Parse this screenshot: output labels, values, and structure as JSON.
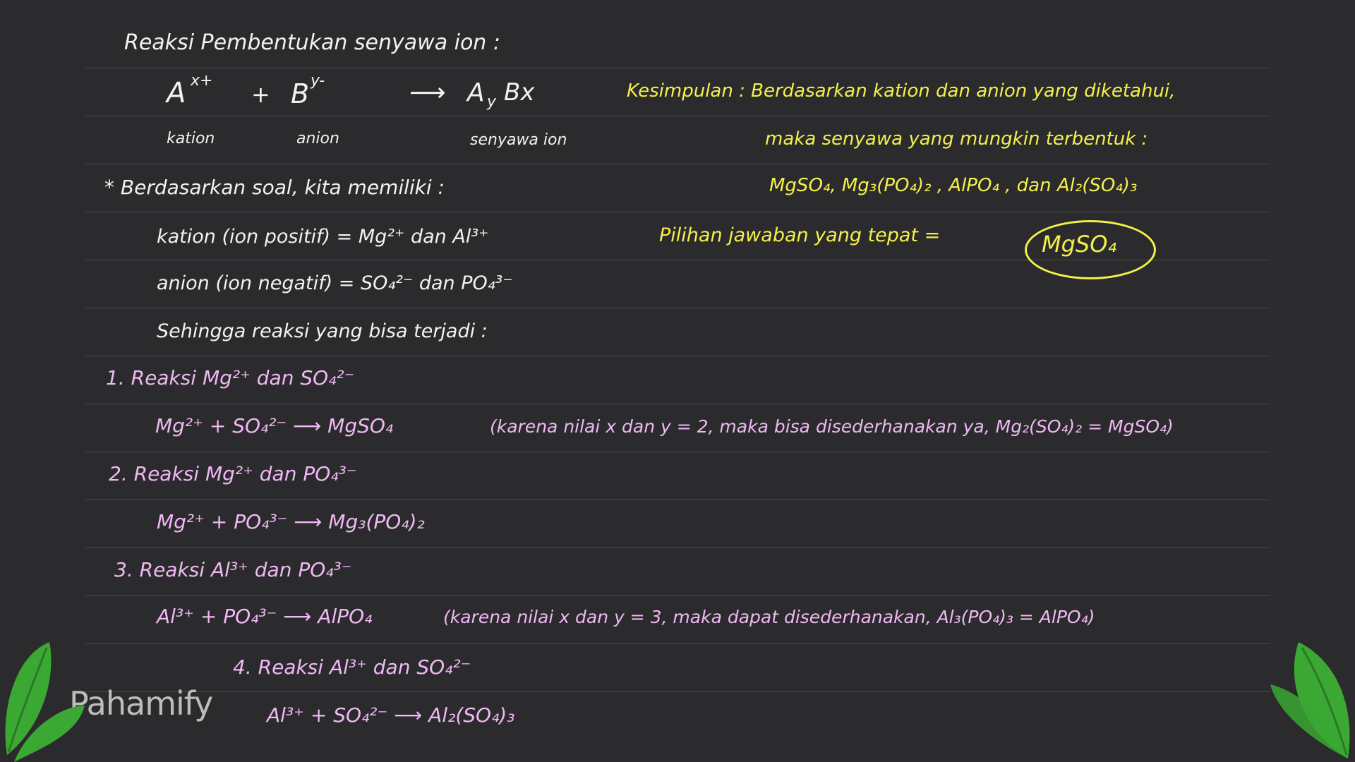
{
  "title": "Reaksi Pembentukan senyawa ion :",
  "general": {
    "cation": "A",
    "cation_charge": "x+",
    "plus": "+",
    "anion": "B",
    "anion_charge": "y-",
    "arrow": "⟶",
    "product": "A",
    "product_sub1": "y",
    "product_b": "Bx",
    "label_cation": "kation",
    "label_anion": "anion",
    "label_product": "senyawa ion"
  },
  "given": {
    "intro": "* Berdasarkan soal, kita memiliki :",
    "cation_line": "kation (ion positif)  =  Mg²⁺  dan  Al³⁺",
    "anion_line": "anion  (ion negatif)  =  SO₄²⁻  dan  PO₄³⁻",
    "so_line": "Sehingga reaksi yang bisa terjadi :"
  },
  "reactions": [
    {
      "heading": "1. Reaksi Mg²⁺ dan SO₄²⁻",
      "equation": "Mg²⁺ + SO₄²⁻  ⟶  MgSO₄",
      "note": "(karena nilai x dan y = 2, maka bisa disederhanakan ya, Mg₂(SO₄)₂ = MgSO₄)"
    },
    {
      "heading": "2. Reaksi Mg²⁺ dan PO₄³⁻",
      "equation": "Mg²⁺ + PO₄³⁻  ⟶  Mg₃(PO₄)₂",
      "note": ""
    },
    {
      "heading": "3. Reaksi Al³⁺ dan PO₄³⁻",
      "equation": "Al³⁺ + PO₄³⁻  ⟶  AlPO₄",
      "note": "(karena nilai x dan y = 3, maka dapat disederhanakan, Al₃(PO₄)₃ = AlPO₄)"
    },
    {
      "heading": "4. Reaksi Al³⁺ dan SO₄²⁻",
      "equation": "Al³⁺ + SO₄²⁻  ⟶  Al₂(SO₄)₃",
      "note": ""
    }
  ],
  "conclusion": {
    "line1": "Kesimpulan :  Berdasarkan kation dan anion yang diketahui,",
    "line2": "maka senyawa yang mungkin terbentuk :",
    "line3": "MgSO₄,  Mg₃(PO₄)₂ ,  AlPO₄ ,  dan  Al₂(SO₄)₃",
    "answer_label": "Pilihan jawaban yang tepat =",
    "answer": "MgSO₄"
  },
  "brand": "Pahamify",
  "colors": {
    "background": "#2b2b2d",
    "white_text": "#f2f2f2",
    "pink_text": "#f0b8f4",
    "yellow_text": "#f4f04a",
    "leaf_green": "#3aa832"
  }
}
